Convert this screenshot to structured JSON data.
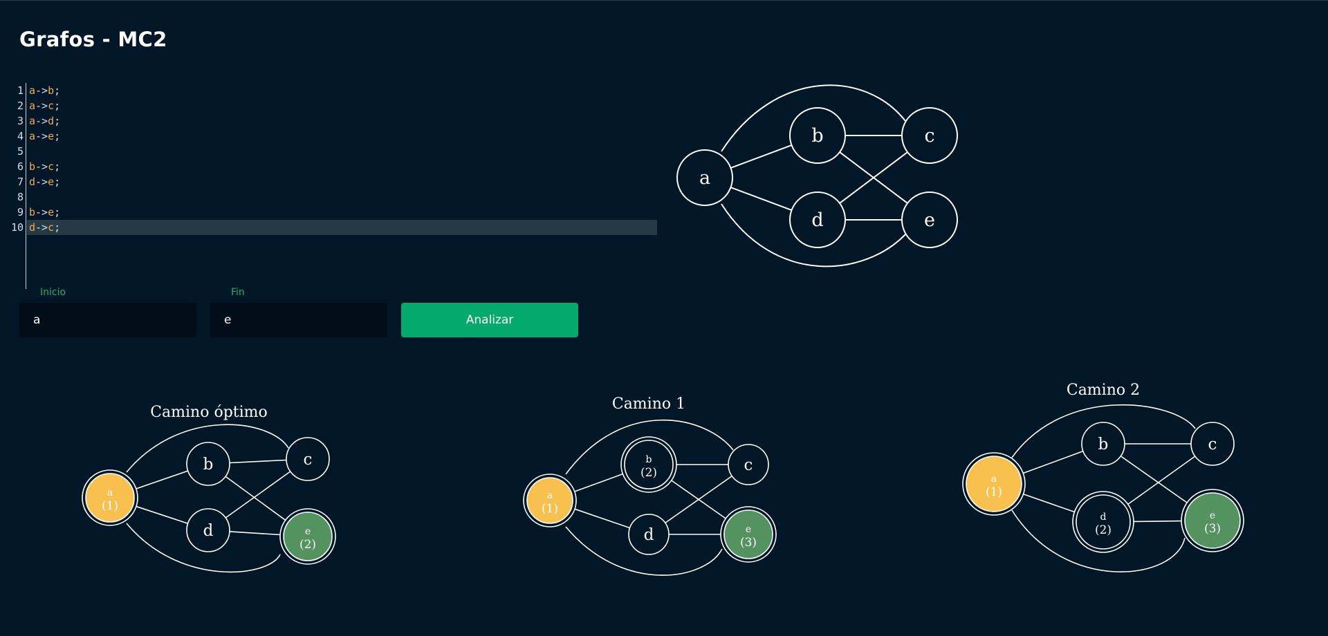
{
  "app": {
    "title": "Grafos - MC2"
  },
  "editor": {
    "active_line": 10,
    "lines": [
      {
        "num": "1",
        "text": "a->b;"
      },
      {
        "num": "2",
        "text": "a->c;"
      },
      {
        "num": "3",
        "text": "a->d;"
      },
      {
        "num": "4",
        "text": "a->e;"
      },
      {
        "num": "5",
        "text": ""
      },
      {
        "num": "6",
        "text": "b->c;"
      },
      {
        "num": "7",
        "text": "d->e;"
      },
      {
        "num": "8",
        "text": ""
      },
      {
        "num": "9",
        "text": "b->e;"
      },
      {
        "num": "10",
        "text": "d->c;"
      }
    ]
  },
  "form": {
    "start_label": "Inicio",
    "start_value": "a",
    "end_label": "Fin",
    "end_value": "e",
    "analyze_label": "Analizar"
  },
  "colors": {
    "background": "#011627",
    "accent": "#04a96d",
    "start_node": "#f7c04f",
    "end_node": "#54935f",
    "token": "#f7a94a"
  },
  "main_graph": {
    "nodes": [
      "a",
      "b",
      "c",
      "d",
      "e"
    ],
    "edges": [
      [
        "a",
        "b"
      ],
      [
        "a",
        "c"
      ],
      [
        "a",
        "d"
      ],
      [
        "a",
        "e"
      ],
      [
        "b",
        "c"
      ],
      [
        "d",
        "e"
      ],
      [
        "b",
        "e"
      ],
      [
        "d",
        "c"
      ]
    ]
  },
  "paths": [
    {
      "title": "Camino óptimo",
      "nodes": [
        {
          "id": "a",
          "label": "a",
          "order": "(1)",
          "role": "start"
        },
        {
          "id": "b",
          "label": "b",
          "order": "",
          "role": "none"
        },
        {
          "id": "c",
          "label": "c",
          "order": "",
          "role": "none"
        },
        {
          "id": "d",
          "label": "d",
          "order": "",
          "role": "none"
        },
        {
          "id": "e",
          "label": "e",
          "order": "(2)",
          "role": "end"
        }
      ]
    },
    {
      "title": "Camino 1",
      "nodes": [
        {
          "id": "a",
          "label": "a",
          "order": "(1)",
          "role": "start"
        },
        {
          "id": "b",
          "label": "b",
          "order": "(2)",
          "role": "via"
        },
        {
          "id": "c",
          "label": "c",
          "order": "",
          "role": "none"
        },
        {
          "id": "d",
          "label": "d",
          "order": "",
          "role": "none"
        },
        {
          "id": "e",
          "label": "e",
          "order": "(3)",
          "role": "end"
        }
      ]
    },
    {
      "title": "Camino 2",
      "nodes": [
        {
          "id": "a",
          "label": "a",
          "order": "(1)",
          "role": "start"
        },
        {
          "id": "b",
          "label": "b",
          "order": "",
          "role": "none"
        },
        {
          "id": "c",
          "label": "c",
          "order": "",
          "role": "none"
        },
        {
          "id": "d",
          "label": "d",
          "order": "(2)",
          "role": "via"
        },
        {
          "id": "e",
          "label": "e",
          "order": "(3)",
          "role": "end"
        }
      ]
    }
  ]
}
